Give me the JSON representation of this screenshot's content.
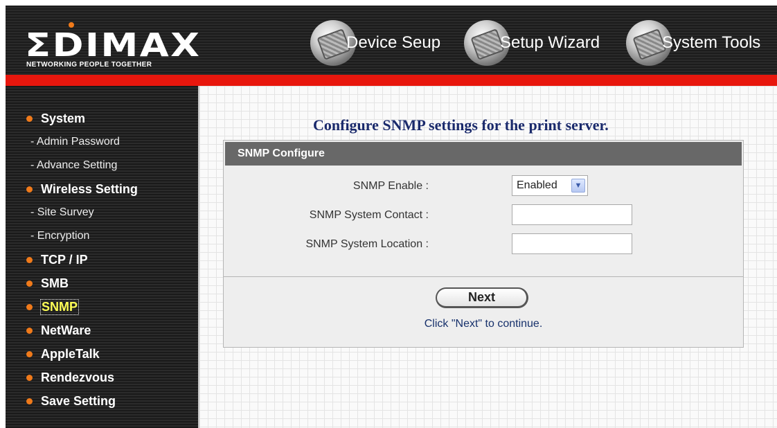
{
  "header": {
    "logo_text": "ΣDIMAX",
    "logo_tagline": "NETWORKING PEOPLE TOGETHER",
    "nav": [
      {
        "label": "Device Seup",
        "icon": "device-icon"
      },
      {
        "label": "Setup Wizard",
        "icon": "wizard-icon"
      },
      {
        "label": "System Tools",
        "icon": "tools-icon"
      }
    ]
  },
  "sidebar": {
    "items": [
      {
        "label": "System",
        "type": "main"
      },
      {
        "label": "- Admin Password",
        "type": "sub"
      },
      {
        "label": "- Advance Setting",
        "type": "sub"
      },
      {
        "label": "Wireless Setting",
        "type": "main"
      },
      {
        "label": "- Site Survey",
        "type": "sub"
      },
      {
        "label": "- Encryption",
        "type": "sub"
      },
      {
        "label": "TCP / IP",
        "type": "main"
      },
      {
        "label": "SMB",
        "type": "main"
      },
      {
        "label": "SNMP",
        "type": "main",
        "active": true
      },
      {
        "label": "NetWare",
        "type": "main"
      },
      {
        "label": "AppleTalk",
        "type": "main"
      },
      {
        "label": "Rendezvous",
        "type": "main"
      },
      {
        "label": "Save Setting",
        "type": "main"
      }
    ]
  },
  "main": {
    "title": "Configure SNMP settings for the print server.",
    "panel_title": "SNMP Configure",
    "fields": {
      "enable_label": "SNMP Enable :",
      "enable_value": "Enabled",
      "contact_label": "SNMP System Contact :",
      "contact_value": "",
      "location_label": "SNMP System Location :",
      "location_value": ""
    },
    "next_label": "Next",
    "hint": "Click \"Next\" to continue."
  },
  "colors": {
    "accent_red": "#e8170d",
    "bullet_orange": "#f07a1a",
    "title_navy": "#1a2a6c",
    "active_yellow": "#ffff55"
  }
}
